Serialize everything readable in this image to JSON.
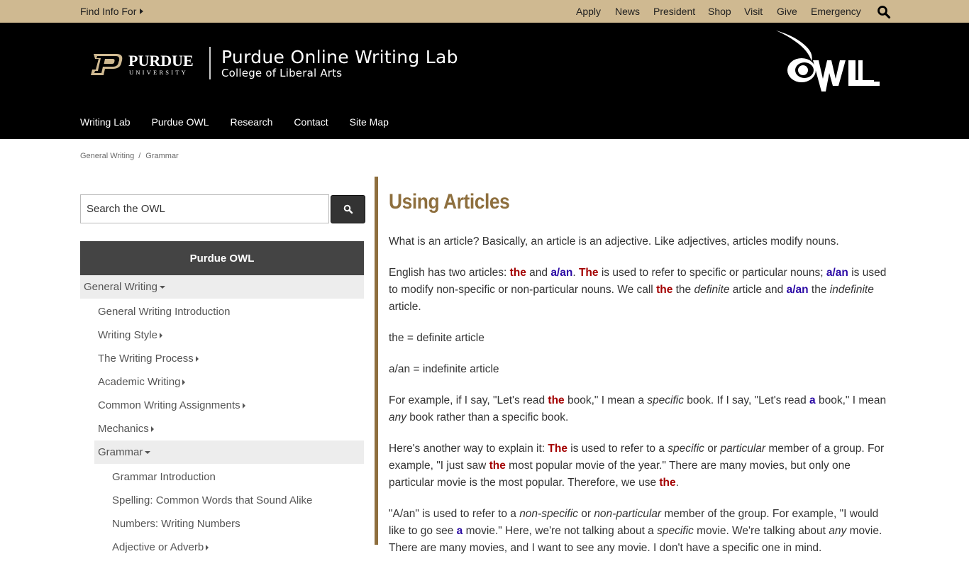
{
  "topbar": {
    "find_info_label": "Find Info For",
    "links": [
      "Apply",
      "News",
      "President",
      "Shop",
      "Visit",
      "Give",
      "Emergency"
    ],
    "search_icon": "search-icon"
  },
  "header": {
    "university_wordmark": "PURDUE",
    "university_sub": "UNIVERSITY",
    "title": "Purdue Online Writing Lab",
    "subtitle": "College of Liberal Arts",
    "owl_logo_text": "OWL",
    "nav": [
      "Writing Lab",
      "Purdue OWL",
      "Research",
      "Contact",
      "Site Map"
    ]
  },
  "breadcrumb": {
    "items": [
      "General Writing",
      "Grammar"
    ],
    "separator": "/"
  },
  "sidebar": {
    "search_placeholder": "Search the OWL",
    "search_button_icon": "search-icon",
    "heading": "Purdue OWL",
    "items": [
      {
        "label": "General Writing",
        "level": 0,
        "icon": "caret-down"
      },
      {
        "label": "General Writing Introduction",
        "level": 1,
        "icon": ""
      },
      {
        "label": "Writing Style",
        "level": 1,
        "icon": "caret-right"
      },
      {
        "label": "The Writing Process",
        "level": 1,
        "icon": "caret-right"
      },
      {
        "label": "Academic Writing",
        "level": 1,
        "icon": "caret-right"
      },
      {
        "label": "Common Writing Assignments",
        "level": 1,
        "icon": "caret-right"
      },
      {
        "label": "Mechanics",
        "level": 1,
        "icon": "caret-right"
      },
      {
        "label": "Grammar",
        "level": 1,
        "icon": "caret-down",
        "open": true
      },
      {
        "label": "Grammar Introduction",
        "level": 2,
        "icon": ""
      },
      {
        "label": "Spelling: Common Words that Sound Alike",
        "level": 2,
        "icon": ""
      },
      {
        "label": "Numbers: Writing Numbers",
        "level": 2,
        "icon": ""
      },
      {
        "label": "Adjective or Adverb",
        "level": 2,
        "icon": "caret-right"
      }
    ]
  },
  "content": {
    "title": "Using Articles",
    "p1": "What is an article? Basically, an article is an adjective. Like adjectives, articles modify nouns.",
    "p2": {
      "t1": "English has two articles: ",
      "the1": "the",
      "t2": " and ",
      "aan1": "a/an",
      "t3": ". ",
      "the2": "The",
      "t4": " is used to refer to specific or particular nouns; ",
      "aan2": "a/an",
      "t5": " is used to modify non-specific or non-particular nouns. We call ",
      "the3": "the",
      "t6": " the ",
      "em1": "definite",
      "t7": " article and ",
      "aan3": "a/an",
      "t8": " the ",
      "em2": "indefinite",
      "t9": " article."
    },
    "p3": "the = definite article",
    "p4": "a/an = indefinite article",
    "p5": {
      "t1": "For example, if I say, \"Let's read ",
      "the1": "the",
      "t2": " book,\" I mean a ",
      "em1": "specific",
      "t3": " book. If I say, \"Let's read ",
      "a1": "a",
      "t4": " book,\" I mean ",
      "em2": "any",
      "t5": " book rather than a specific book."
    },
    "p6": {
      "t1": "Here's another way to explain it: ",
      "the1": "The",
      "t2": " is used to refer to a ",
      "em1": "specific",
      "t3": " or ",
      "em2": "particular",
      "t4": " member of a group. For example, \"I just saw ",
      "the2": "the",
      "t5": " most popular movie of the year.\" There are many movies, but only one particular movie is the most popular. Therefore, we use ",
      "the3": "the",
      "t6": "."
    },
    "p7": {
      "t1": "\"A/an\" is used to refer to a ",
      "em1": "non-specific",
      "t2": " or ",
      "em2": "non-particular",
      "t3": " member of the group. For example, \"I would like to go see ",
      "a1": "a",
      "t4": " movie.\" Here, we're not talking about a ",
      "em3": "specific",
      "t5": " movie. We're talking about ",
      "em4": "any",
      "t6": " movie. There are many movies, and I want to see any movie. I don't have a specific one in mind."
    }
  },
  "colors": {
    "gold": "#cfb991",
    "header_bg": "#000000",
    "accent_brown": "#8e6f3e",
    "definite_red": "#a30000",
    "indefinite_blue": "#2b0aa5",
    "sidebar_head": "#444444",
    "sidebar_active": "#ededed"
  }
}
